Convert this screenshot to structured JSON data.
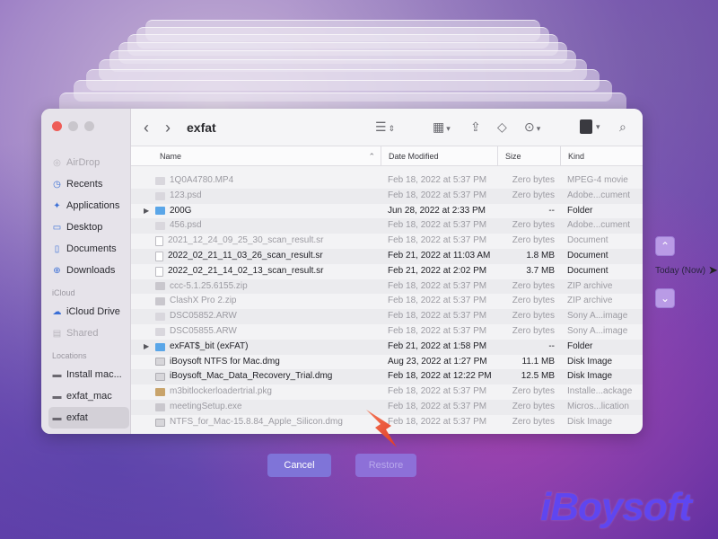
{
  "window": {
    "title": "exfat",
    "back_icon": "chevron-left-icon",
    "forward_icon": "chevron-right-icon"
  },
  "sidebar": {
    "favorites": [
      {
        "label": "AirDrop",
        "icon": "airdrop-icon",
        "dim": true
      },
      {
        "label": "Recents",
        "icon": "clock-icon"
      },
      {
        "label": "Applications",
        "icon": "applications-icon"
      },
      {
        "label": "Desktop",
        "icon": "desktop-icon"
      },
      {
        "label": "Documents",
        "icon": "document-icon"
      },
      {
        "label": "Downloads",
        "icon": "download-icon"
      }
    ],
    "icloud_header": "iCloud",
    "icloud": [
      {
        "label": "iCloud Drive",
        "icon": "cloud-icon"
      },
      {
        "label": "Shared",
        "icon": "shared-folder-icon",
        "dim": true
      }
    ],
    "locations_header": "Locations",
    "locations": [
      {
        "label": "Install mac...",
        "icon": "drive-icon"
      },
      {
        "label": "exfat_mac",
        "icon": "drive-icon"
      },
      {
        "label": "exfat",
        "icon": "drive-icon",
        "active": true
      }
    ]
  },
  "columns": {
    "name": "Name",
    "date": "Date Modified",
    "size": "Size",
    "kind": "Kind"
  },
  "files": [
    {
      "name": "1Q0A4780.MP4",
      "date": "Feb 18, 2022 at 5:37 PM",
      "size": "Zero bytes",
      "kind": "MPEG-4 movie",
      "icon": "img",
      "dim": true
    },
    {
      "name": "123.psd",
      "date": "Feb 18, 2022 at 5:37 PM",
      "size": "Zero bytes",
      "kind": "Adobe...cument",
      "icon": "img",
      "dim": true
    },
    {
      "name": "200G",
      "date": "Jun 28, 2022 at 2:33 PM",
      "size": "--",
      "kind": "Folder",
      "icon": "folder",
      "disclosure": true
    },
    {
      "name": "456.psd",
      "date": "Feb 18, 2022 at 5:37 PM",
      "size": "Zero bytes",
      "kind": "Adobe...cument",
      "icon": "img",
      "dim": true
    },
    {
      "name": "2021_12_24_09_25_30_scan_result.sr",
      "date": "Feb 18, 2022 at 5:37 PM",
      "size": "Zero bytes",
      "kind": "Document",
      "icon": "doc",
      "dim": true
    },
    {
      "name": "2022_02_21_11_03_26_scan_result.sr",
      "date": "Feb 21, 2022 at 11:03 AM",
      "size": "1.8 MB",
      "kind": "Document",
      "icon": "doc"
    },
    {
      "name": "2022_02_21_14_02_13_scan_result.sr",
      "date": "Feb 21, 2022 at 2:02 PM",
      "size": "3.7 MB",
      "kind": "Document",
      "icon": "doc"
    },
    {
      "name": "ccc-5.1.25.6155.zip",
      "date": "Feb 18, 2022 at 5:37 PM",
      "size": "Zero bytes",
      "kind": "ZIP archive",
      "icon": "zip",
      "dim": true
    },
    {
      "name": "ClashX Pro 2.zip",
      "date": "Feb 18, 2022 at 5:37 PM",
      "size": "Zero bytes",
      "kind": "ZIP archive",
      "icon": "zip",
      "dim": true
    },
    {
      "name": "DSC05852.ARW",
      "date": "Feb 18, 2022 at 5:37 PM",
      "size": "Zero bytes",
      "kind": "Sony A...image",
      "icon": "img",
      "dim": true
    },
    {
      "name": "DSC05855.ARW",
      "date": "Feb 18, 2022 at 5:37 PM",
      "size": "Zero bytes",
      "kind": "Sony A...image",
      "icon": "img",
      "dim": true
    },
    {
      "name": "exFAT$_bit (exFAT)",
      "date": "Feb 21, 2022 at 1:58 PM",
      "size": "--",
      "kind": "Folder",
      "icon": "folder",
      "disclosure": true
    },
    {
      "name": "iBoysoft NTFS for Mac.dmg",
      "date": "Aug 23, 2022 at 1:27 PM",
      "size": "11.1 MB",
      "kind": "Disk Image",
      "icon": "dmg"
    },
    {
      "name": "iBoysoft_Mac_Data_Recovery_Trial.dmg",
      "date": "Feb 18, 2022 at 12:22 PM",
      "size": "12.5 MB",
      "kind": "Disk Image",
      "icon": "dmg"
    },
    {
      "name": "m3bitlockerloadertrial.pkg",
      "date": "Feb 18, 2022 at 5:37 PM",
      "size": "Zero bytes",
      "kind": "Installe...ackage",
      "icon": "pkg",
      "dim": true
    },
    {
      "name": "meetingSetup.exe",
      "date": "Feb 18, 2022 at 5:37 PM",
      "size": "Zero bytes",
      "kind": "Micros...lication",
      "icon": "zip",
      "dim": true
    },
    {
      "name": "NTFS_for_Mac-15.8.84_Apple_Silicon.dmg",
      "date": "Feb 18, 2022 at 5:37 PM",
      "size": "Zero bytes",
      "kind": "Disk Image",
      "icon": "dmg",
      "dim": true
    }
  ],
  "timeline": {
    "up_icon": "chevron-up-icon",
    "label": "Today (Now)",
    "down_icon": "chevron-down-icon"
  },
  "buttons": {
    "cancel": "Cancel",
    "restore": "Restore"
  },
  "brand": {
    "logo_text": "iBoysoft"
  },
  "colors": {
    "accent": "#7f74d8",
    "folder": "#5aa6e8",
    "brand": "#5f46f0",
    "arrow": "#f0533a"
  }
}
